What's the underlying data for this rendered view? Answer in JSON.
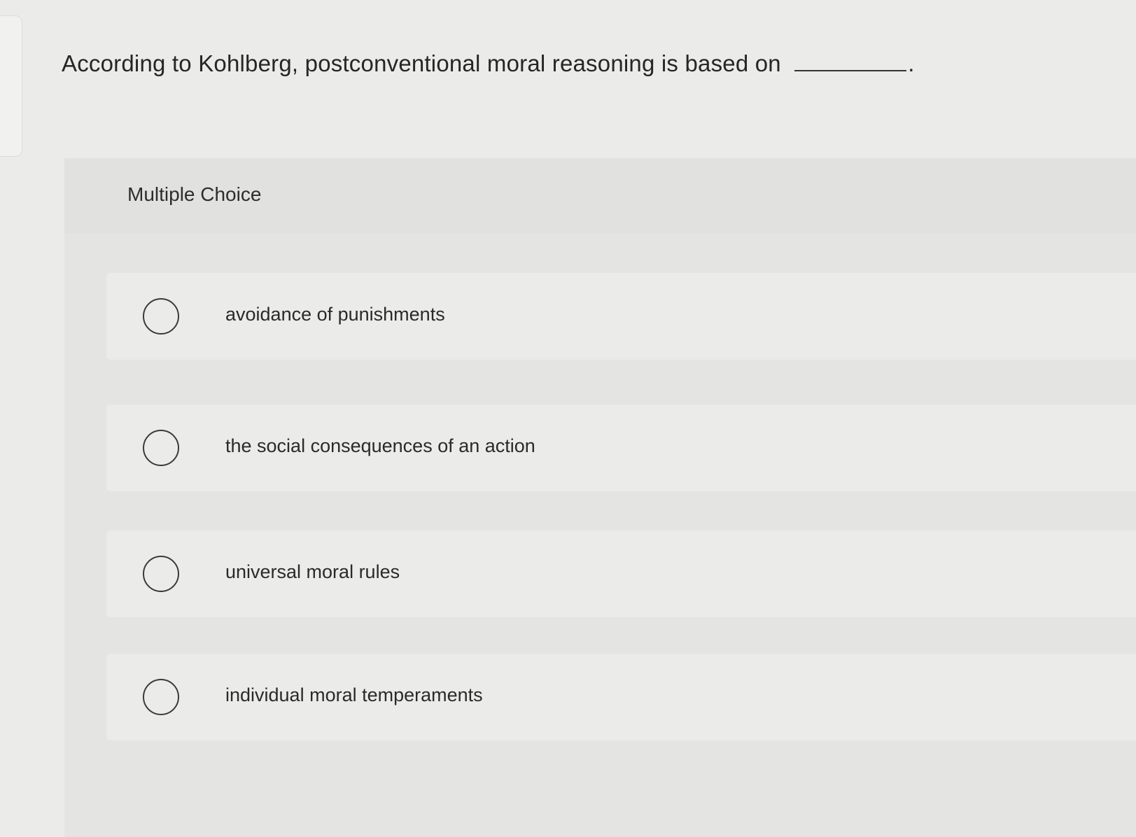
{
  "question": {
    "text": "According to Kohlberg, postconventional moral reasoning is based on",
    "trailing": "."
  },
  "section_label": "Multiple Choice",
  "options": [
    {
      "label": "avoidance of punishments",
      "selected": false
    },
    {
      "label": "the social consequences of an action",
      "selected": false
    },
    {
      "label": "universal moral rules",
      "selected": false
    },
    {
      "label": "individual moral temperaments",
      "selected": false
    }
  ]
}
